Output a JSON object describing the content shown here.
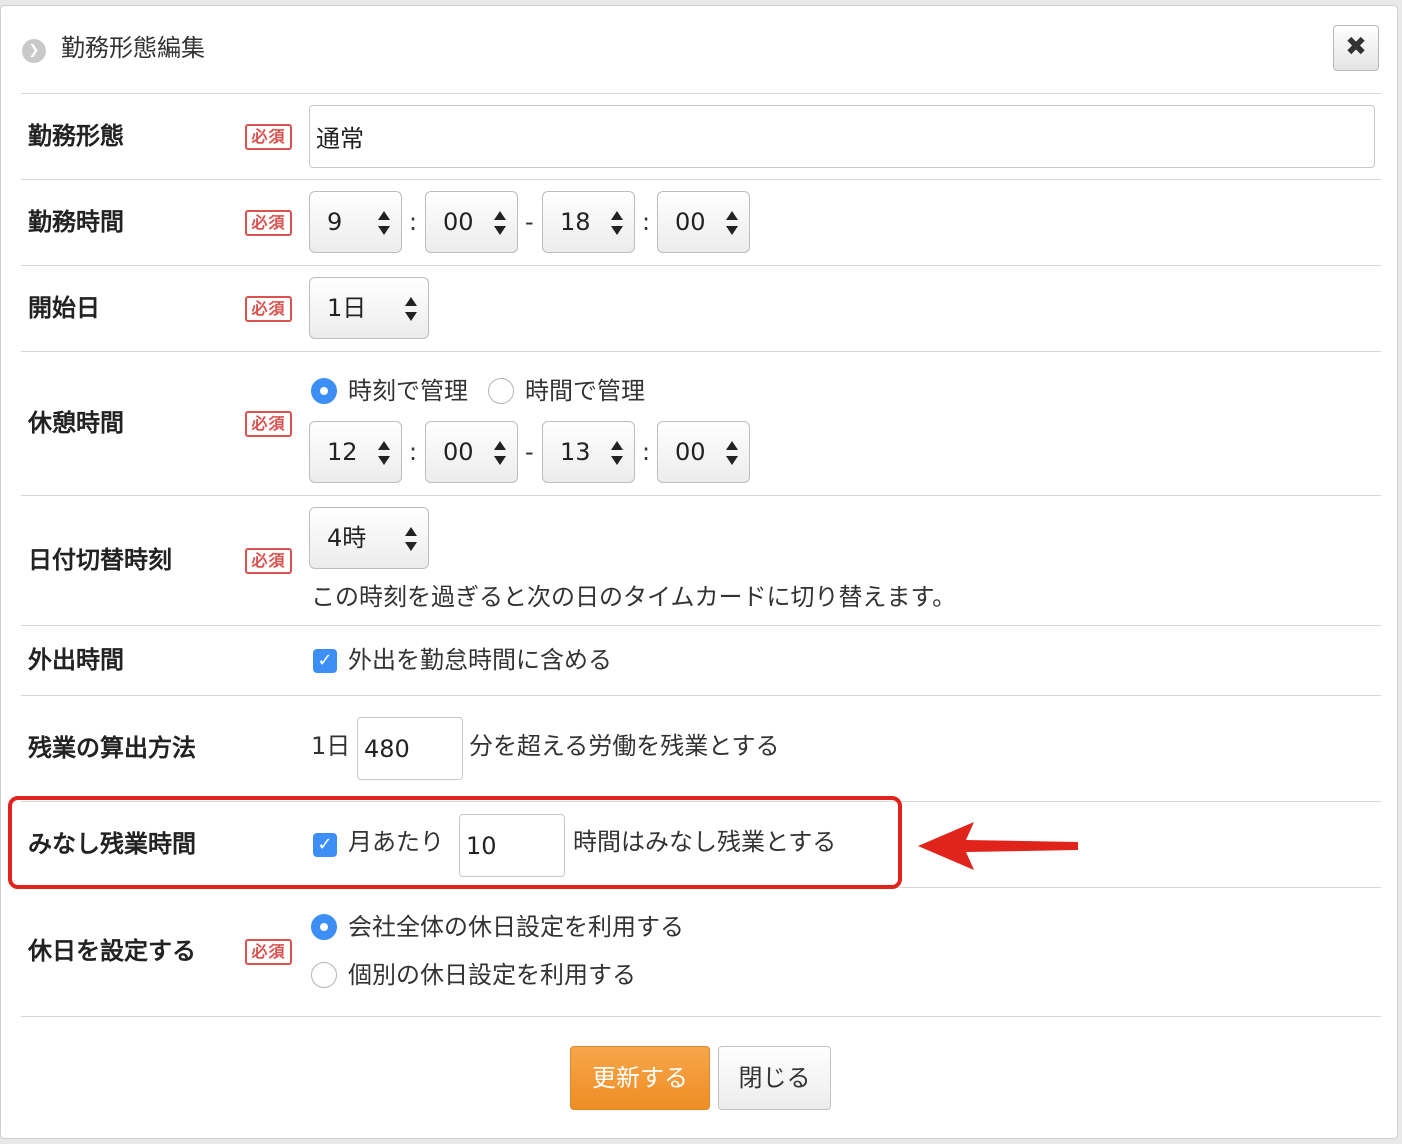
{
  "dialog": {
    "title": "勤務形態編集",
    "close_icon": "close-icon",
    "required_badge": "必須"
  },
  "fields": {
    "work_type": {
      "label": "勤務形態",
      "value": "通常"
    },
    "work_hours": {
      "label": "勤務時間",
      "start_hour": "9",
      "start_min": "00",
      "end_hour": "18",
      "end_min": "00",
      "colon": ":",
      "dash": "-"
    },
    "start_day": {
      "label": "開始日",
      "value": "1日"
    },
    "break_time": {
      "label": "休憩時間",
      "opt_clock": "時刻で管理",
      "opt_duration": "時間で管理",
      "selected": "時刻で管理",
      "start_hour": "12",
      "start_min": "00",
      "end_hour": "13",
      "end_min": "00"
    },
    "date_switch": {
      "label": "日付切替時刻",
      "value": "4時",
      "note": "この時刻を過ぎると次の日のタイムカードに切り替えます。"
    },
    "outing": {
      "label": "外出時間",
      "checkbox_label": "外出を勤怠時間に含める",
      "checked": true
    },
    "overtime_calc": {
      "label": "残業の算出方法",
      "prefix": "1日",
      "value": "480",
      "suffix": "分を超える労働を残業とする"
    },
    "deemed_overtime": {
      "label": "みなし残業時間",
      "checkbox_label": "月あたり",
      "checked": true,
      "value": "10",
      "suffix": "時間はみなし残業とする"
    },
    "holiday": {
      "label": "休日を設定する",
      "opt_company": "会社全体の休日設定を利用する",
      "opt_individual": "個別の休日設定を利用する",
      "selected": "会社全体の休日設定を利用する"
    }
  },
  "buttons": {
    "update": "更新する",
    "close": "閉じる"
  },
  "colors": {
    "accent": "#ef8d25",
    "required": "#d9534f",
    "highlight": "#e0241b",
    "check": "#3d8ff5"
  }
}
